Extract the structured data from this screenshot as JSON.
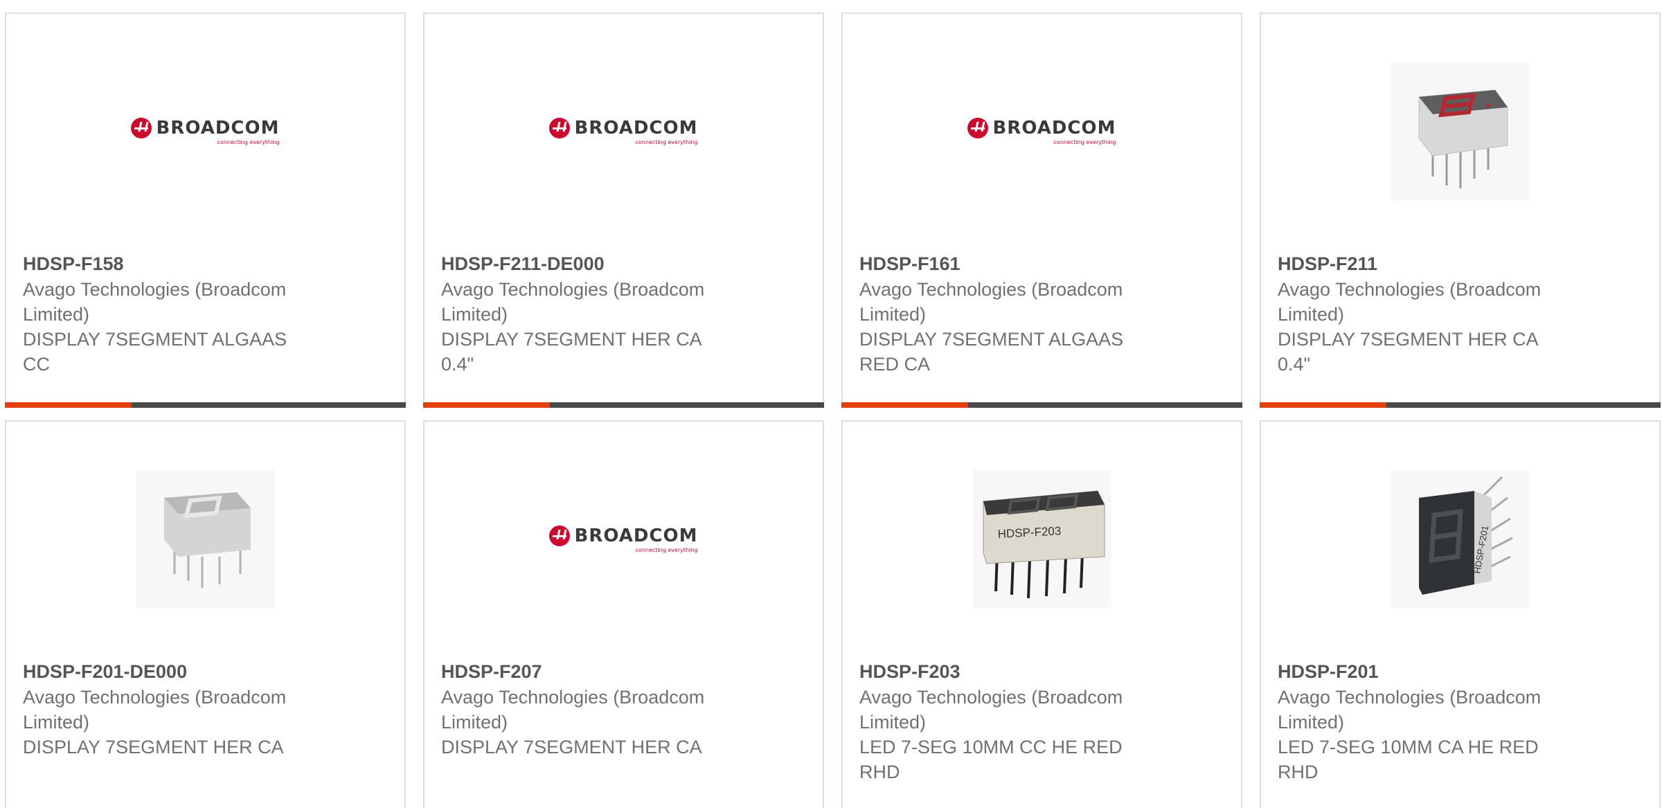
{
  "brand": {
    "logo_word": "BROADCOM",
    "logo_tagline": "connecting everything",
    "colors": {
      "logo_red": "#cc092f",
      "accent_bar": "#e0410f",
      "bar_dark": "#4a4a4a"
    }
  },
  "products": [
    {
      "part_number": "HDSP-F158",
      "manufacturer": "Avago Technologies (Broadcom Limited)",
      "description": "DISPLAY 7SEGMENT ALGAAS CC",
      "image": "broadcom-logo"
    },
    {
      "part_number": "HDSP-F211-DE000",
      "manufacturer": "Avago Technologies (Broadcom Limited)",
      "description": "DISPLAY 7SEGMENT HER CA 0.4\"",
      "image": "broadcom-logo"
    },
    {
      "part_number": "HDSP-F161",
      "manufacturer": "Avago Technologies (Broadcom Limited)",
      "description": "DISPLAY 7SEGMENT ALGAAS RED CA",
      "image": "broadcom-logo"
    },
    {
      "part_number": "HDSP-F211",
      "manufacturer": "Avago Technologies (Broadcom Limited)",
      "description": "DISPLAY 7SEGMENT HER CA 0.4\"",
      "image": "seven-segment-red-photo"
    },
    {
      "part_number": "HDSP-F201-DE000",
      "manufacturer": "Avago Technologies (Broadcom Limited)",
      "description": "DISPLAY 7SEGMENT HER CA",
      "image": "seven-segment-grey-photo"
    },
    {
      "part_number": "HDSP-F207",
      "manufacturer": "Avago Technologies (Broadcom Limited)",
      "description": "DISPLAY 7SEGMENT HER CA",
      "image": "broadcom-logo"
    },
    {
      "part_number": "HDSP-F203",
      "manufacturer": "Avago Technologies (Broadcom Limited)",
      "description": "LED 7-SEG 10MM CC HE RED RHD",
      "image": "dual-digit-display-photo",
      "image_label": "HDSP-F203"
    },
    {
      "part_number": "HDSP-F201",
      "manufacturer": "Avago Technologies (Broadcom Limited)",
      "description": "LED 7-SEG 10MM CA HE RED RHD",
      "image": "seven-segment-dark-photo",
      "image_label": "HDSP-F201"
    }
  ]
}
